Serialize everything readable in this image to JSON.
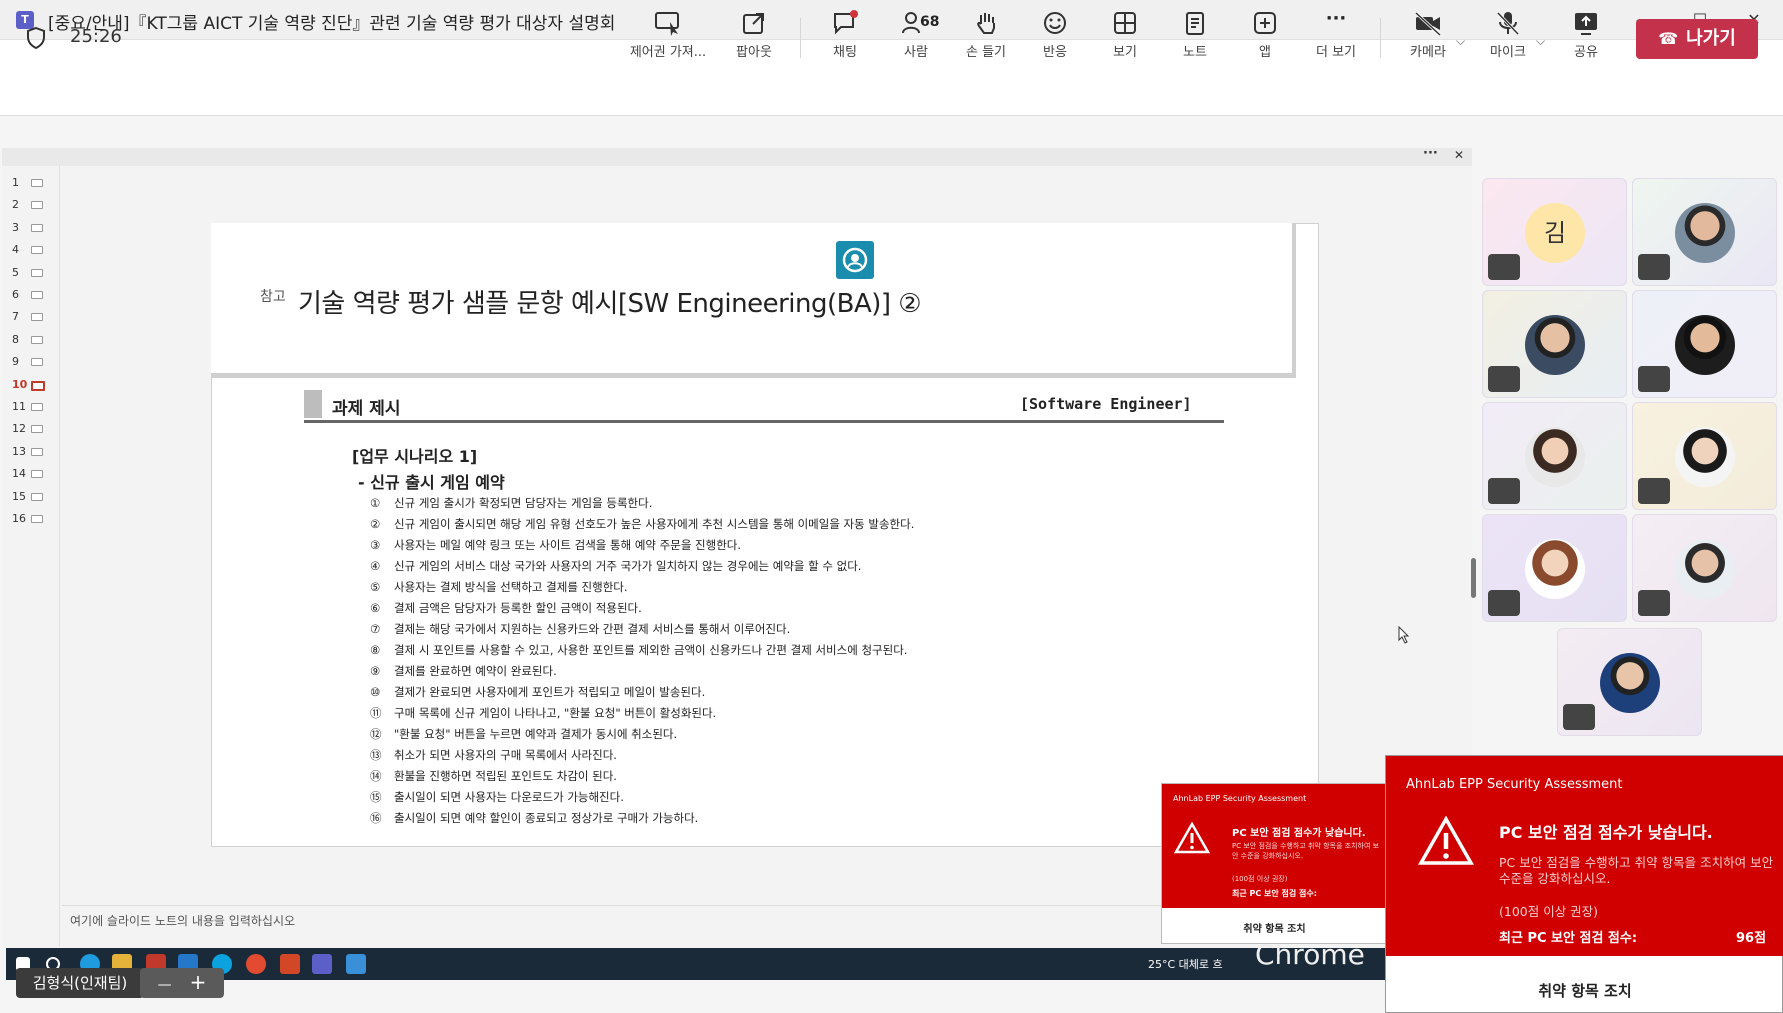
{
  "window": {
    "title": "[중요/안내]『KT그룹 AICT 기술 역량 진단』관련 기술 역량 평가 대상자 설명회",
    "controls": {
      "more": "···",
      "minimize": "—",
      "maximize": "☐",
      "close": "✕"
    }
  },
  "toolbar": {
    "timer": "25:26",
    "take_control": "제어권 가져...",
    "popout": "팝아웃",
    "chat": "채팅",
    "people": "사람",
    "people_count": "68",
    "raise_hand": "손 들기",
    "react": "반응",
    "view": "보기",
    "notes": "노트",
    "apps": "앱",
    "more": "더 보기",
    "camera": "카메라",
    "mic": "마이크",
    "share": "공유",
    "leave": "나가기",
    "more_glyph": "···"
  },
  "stage": {
    "more": "···",
    "close": "✕"
  },
  "slide_rail": {
    "items": [
      "1",
      "2",
      "3",
      "4",
      "5",
      "6",
      "7",
      "8",
      "9",
      "10",
      "11",
      "12",
      "13",
      "14",
      "15",
      "16"
    ],
    "selected": "10"
  },
  "slide": {
    "ref_label": "참고",
    "title": "기술 역량 평가 샘플 문항 예시[SW Engineering(BA)] ②",
    "task_title": "과제 제시",
    "task_role": "[Software Engineer]",
    "scenario_title": "[업무 시나리오 1]",
    "scenario_sub": "- 신규 출시 게임 예약",
    "steps": [
      {
        "n": "①",
        "text": "신규 게임 출시가 확정되면 담당자는 게임을 등록한다."
      },
      {
        "n": "②",
        "text": "신규 게임이 출시되면 해당 게임 유형 선호도가 높은 사용자에게 추천 시스템을 통해 이메일을 자동 발송한다."
      },
      {
        "n": "③",
        "text": "사용자는 메일 예약 링크 또는 사이트 검색을 통해 예약 주문을 진행한다."
      },
      {
        "n": "④",
        "text": "신규 게임의 서비스 대상 국가와 사용자의 거주 국가가 일치하지 않는 경우에는 예약을 할 수 없다."
      },
      {
        "n": "⑤",
        "text": "사용자는 결제 방식을 선택하고 결제를 진행한다."
      },
      {
        "n": "⑥",
        "text": "결제 금액은 담당자가 등록한 할인 금액이 적용된다."
      },
      {
        "n": "⑦",
        "text": "결제는 해당 국가에서 지원하는 신용카드와 간편 결제 서비스를 통해서 이루어진다."
      },
      {
        "n": "⑧",
        "text": "결제 시 포인트를 사용할 수 있고, 사용한 포인트를 제외한 금액이 신용카드나 간편 결제 서비스에 청구된다."
      },
      {
        "n": "⑨",
        "text": "결제를 완료하면 예약이 완료된다."
      },
      {
        "n": "⑩",
        "text": "결제가 완료되면 사용자에게 포인트가 적립되고 메일이 발송된다."
      },
      {
        "n": "⑪",
        "text": "구매 목록에 신규 게임이 나타나고, \"환불 요청\" 버튼이 활성화된다."
      },
      {
        "n": "⑫",
        "text": "\"환불 요청\" 버튼을 누르면 예약과 결제가 동시에 취소된다."
      },
      {
        "n": "⑬",
        "text": "취소가 되면 사용자의 구매 목록에서 사라진다."
      },
      {
        "n": "⑭",
        "text": "환불을 진행하면 적립된 포인트도 차감이 된다."
      },
      {
        "n": "⑮",
        "text": "출시일이 되면 사용자는 다운로드가 가능해진다."
      },
      {
        "n": "⑯",
        "text": "출시일이 되면 예약 할인이 종료되고 정상가로 구매가 가능하다."
      }
    ]
  },
  "notes": {
    "placeholder": "여기에 슬라이드 노트의 내용을 입력하십시오"
  },
  "taskbar": {
    "weather": "25°C  대체로 흐",
    "chrome_label": "Chrome"
  },
  "presenter": {
    "name": "김형식(인재팀)",
    "minus": "—",
    "plus": "+"
  },
  "participants": {
    "initial_tile": "김",
    "colors": {
      "accent": "#5b5fc7",
      "leave": "#c4314b",
      "alert": "#d10000"
    }
  },
  "popup_small": {
    "header": "AhnLab EPP Security Assessment",
    "title": "PC 보안 점검 점수가 낮습니다.",
    "desc": "PC 보안 점검을 수행하고 취약 항목을 조치하여 보안 수준을 강화하십시오.",
    "recommend": "(100점 이상 권장)",
    "score_label": "최근 PC 보안 점검 점수:",
    "button": "취약 항목 조치"
  },
  "popup_large": {
    "header": "AhnLab EPP Security Assessment",
    "title": "PC 보안 점검 점수가 낮습니다.",
    "desc_line1": "PC 보안 점검을 수행하고 취약 항목을 조치하여 보안",
    "desc_line2": "수준을 강화하십시오.",
    "recommend": "(100점 이상 권장)",
    "score_label": "최근 PC 보안 점검 점수:",
    "score_value": "96점",
    "button": "취약 항목 조치"
  }
}
